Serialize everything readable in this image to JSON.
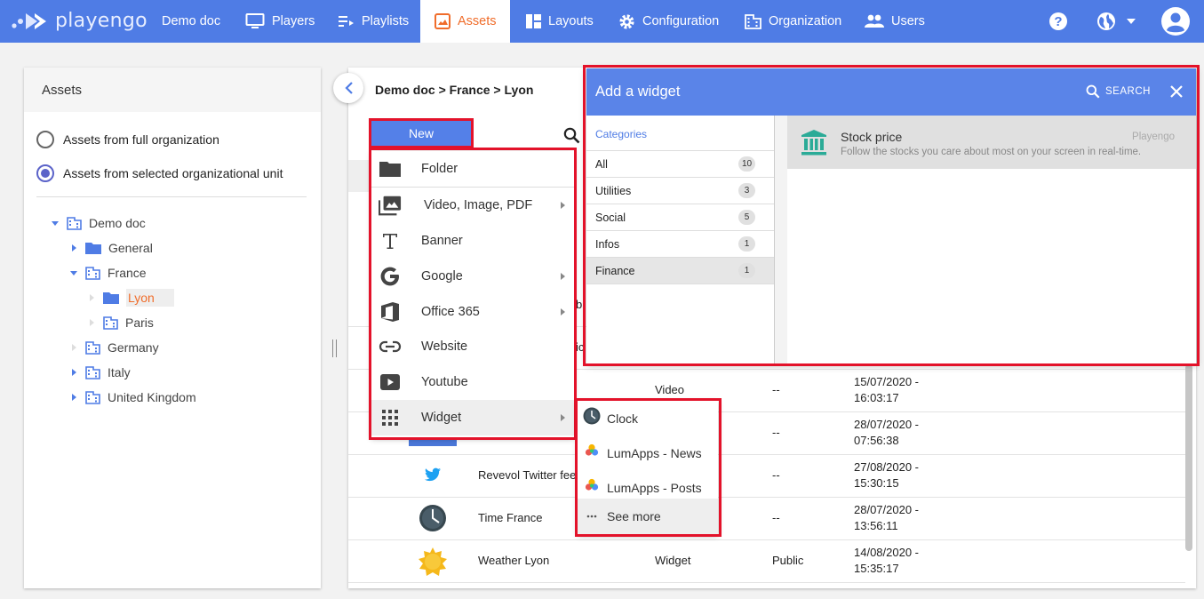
{
  "app": {
    "brand": "playengo",
    "colors": {
      "topbar": "#4f7ce5",
      "accent": "#f06d2b",
      "primary_button": "#5480e8",
      "highlight": "#e3122a"
    }
  },
  "nav": {
    "items": [
      {
        "label": "Demo doc",
        "icon": ""
      },
      {
        "label": "Players",
        "icon": "monitor-icon"
      },
      {
        "label": "Playlists",
        "icon": "playlist-icon"
      },
      {
        "label": "Assets",
        "icon": "image-icon",
        "active": true
      },
      {
        "label": "Layouts",
        "icon": "layout-icon"
      },
      {
        "label": "Configuration",
        "icon": "gear-icon"
      },
      {
        "label": "Organization",
        "icon": "building-icon"
      },
      {
        "label": "Users",
        "icon": "users-icon"
      }
    ],
    "right_icons": [
      "help-icon",
      "globe-icon",
      "chevron-down-icon",
      "account-icon"
    ]
  },
  "left_panel": {
    "title": "Assets",
    "radio_full": "Assets from full organization",
    "radio_selected": "Assets from selected organizational unit",
    "tree": [
      {
        "label": "Demo doc",
        "type": "org",
        "expanded": true
      },
      {
        "label": "General",
        "type": "folder",
        "expanded": false
      },
      {
        "label": "France",
        "type": "org",
        "expanded": true
      },
      {
        "label": "Lyon",
        "type": "folder",
        "selected": true
      },
      {
        "label": "Paris",
        "type": "org"
      },
      {
        "label": "Germany",
        "type": "org"
      },
      {
        "label": "Italy",
        "type": "org"
      },
      {
        "label": "United Kingdom",
        "type": "org"
      }
    ]
  },
  "center": {
    "breadcrumb": "Demo doc > France > Lyon",
    "partial_texts": [
      "b",
      "ic"
    ],
    "rows": [
      {
        "name": "",
        "type": "Video",
        "visibility": "--",
        "date": "15/07/2020 -",
        "time": "16:03:17",
        "icon": "video-thumb"
      },
      {
        "name": "",
        "type": "",
        "visibility": "--",
        "date": "28/07/2020 -",
        "time": "07:56:38",
        "icon": "banner-thumb"
      },
      {
        "name": "Revevol Twitter fee",
        "type": "",
        "visibility": "--",
        "date": "27/08/2020 -",
        "time": "15:30:15",
        "icon": "twitter-icon"
      },
      {
        "name": "Time France",
        "type": "",
        "visibility": "--",
        "date": "28/07/2020 -",
        "time": "13:56:11",
        "icon": "clock-icon"
      },
      {
        "name": "Weather Lyon",
        "type": "Widget",
        "visibility": "Public",
        "date": "14/08/2020 -",
        "time": "15:35:17",
        "icon": "sun-icon"
      }
    ]
  },
  "new_menu": {
    "button": "New",
    "items": [
      {
        "label": "Folder",
        "icon": "folder-icon",
        "submenu": false
      },
      {
        "label": "Video, Image, PDF",
        "icon": "media-icon",
        "submenu": true
      },
      {
        "label": "Banner",
        "icon": "text-icon",
        "submenu": false
      },
      {
        "label": "Google",
        "icon": "google-icon",
        "submenu": true
      },
      {
        "label": "Office 365",
        "icon": "office-icon",
        "submenu": true
      },
      {
        "label": "Website",
        "icon": "link-icon",
        "submenu": false
      },
      {
        "label": "Youtube",
        "icon": "youtube-icon",
        "submenu": false
      },
      {
        "label": "Widget",
        "icon": "apps-icon",
        "submenu": true
      }
    ]
  },
  "widget_submenu": {
    "items": [
      {
        "label": "Clock",
        "icon": "clock-icon"
      },
      {
        "label": "LumApps - News",
        "icon": "lumapps-icon"
      },
      {
        "label": "LumApps - Posts",
        "icon": "lumapps-icon"
      },
      {
        "label": "See more",
        "icon": "more-icon"
      }
    ]
  },
  "dialog": {
    "title": "Add a widget",
    "search_label": "SEARCH",
    "categories_header": "Categories",
    "categories": [
      {
        "name": "All",
        "count": "10"
      },
      {
        "name": "Utilities",
        "count": "3"
      },
      {
        "name": "Social",
        "count": "5"
      },
      {
        "name": "Infos",
        "count": "1"
      },
      {
        "name": "Finance",
        "count": "1",
        "selected": true
      }
    ],
    "widget": {
      "title": "Stock price",
      "description": "Follow the stocks you care about most on your screen in real-time.",
      "vendor": "Playengo",
      "icon": "bank-icon"
    }
  }
}
